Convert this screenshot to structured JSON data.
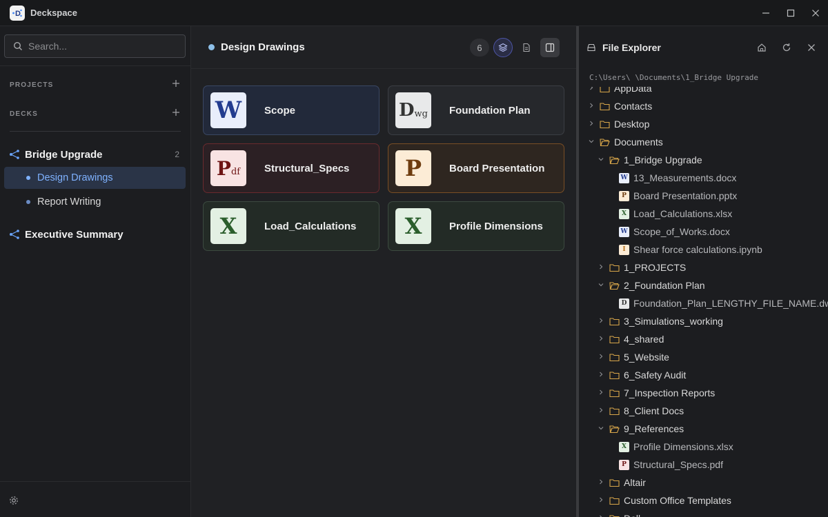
{
  "app": {
    "title": "Deckspace",
    "logo": "D"
  },
  "window_controls": [
    "minimize-icon",
    "maximize-icon",
    "close-icon"
  ],
  "sidebar": {
    "search_placeholder": "Search...",
    "sections": {
      "projects": "PROJECTS",
      "decks": "DECKS"
    },
    "projects": [
      {
        "title": "Bridge Upgrade",
        "count": "2",
        "decks": [
          {
            "label": "Design Drawings",
            "active": true
          },
          {
            "label": "Report Writing",
            "active": false
          }
        ]
      },
      {
        "title": "Executive Summary",
        "count": "",
        "decks": []
      }
    ]
  },
  "main": {
    "deck_title": "Design Drawings",
    "card_count": "6",
    "cards": [
      {
        "label": "Scope",
        "type": "word",
        "glyph": "W"
      },
      {
        "label": "Foundation Plan",
        "type": "dwg",
        "glyph": "D",
        "glyph_sub": "wg"
      },
      {
        "label": "Structural_Specs",
        "type": "pdf",
        "glyph": "P",
        "glyph_sub": "df"
      },
      {
        "label": "Board Presentation",
        "type": "ppt",
        "glyph": "P"
      },
      {
        "label": "Load_Calculations",
        "type": "excel",
        "glyph": "X"
      },
      {
        "label": "Profile Dimensions",
        "type": "excel",
        "glyph": "X"
      }
    ]
  },
  "explorer": {
    "title": "File Explorer",
    "path": "C:\\Users\\        \\Documents\\1_Bridge Upgrade",
    "tree": [
      {
        "label": "AppData",
        "kind": "folder",
        "depth": 0,
        "open": false
      },
      {
        "label": "Contacts",
        "kind": "folder",
        "depth": 0,
        "open": false
      },
      {
        "label": "Desktop",
        "kind": "folder",
        "depth": 0,
        "open": false
      },
      {
        "label": "Documents",
        "kind": "folder",
        "depth": 0,
        "open": true
      },
      {
        "label": "1_Bridge Upgrade",
        "kind": "folder",
        "depth": 1,
        "open": true
      },
      {
        "label": "13_Measurements.docx",
        "kind": "word",
        "depth": 2
      },
      {
        "label": "Board Presentation.pptx",
        "kind": "ppt",
        "depth": 2
      },
      {
        "label": "Load_Calculations.xlsx",
        "kind": "excel",
        "depth": 2
      },
      {
        "label": "Scope_of_Works.docx",
        "kind": "word",
        "depth": 2
      },
      {
        "label": "Shear force calculations.ipynb",
        "kind": "ipynb",
        "depth": 2
      },
      {
        "label": "1_PROJECTS",
        "kind": "folder",
        "depth": 1,
        "open": false
      },
      {
        "label": "2_Foundation Plan",
        "kind": "folder",
        "depth": 1,
        "open": true
      },
      {
        "label": "Foundation_Plan_LENGTHY_FILE_NAME.dwg",
        "kind": "dwg",
        "depth": 2
      },
      {
        "label": "3_Simulations_working",
        "kind": "folder",
        "depth": 1,
        "open": false
      },
      {
        "label": "4_shared",
        "kind": "folder",
        "depth": 1,
        "open": false
      },
      {
        "label": "5_Website",
        "kind": "folder",
        "depth": 1,
        "open": false
      },
      {
        "label": "6_Safety Audit",
        "kind": "folder",
        "depth": 1,
        "open": false
      },
      {
        "label": "7_Inspection Reports",
        "kind": "folder",
        "depth": 1,
        "open": false
      },
      {
        "label": "8_Client Docs",
        "kind": "folder",
        "depth": 1,
        "open": false
      },
      {
        "label": "9_References",
        "kind": "folder",
        "depth": 1,
        "open": true
      },
      {
        "label": "Profile Dimensions.xlsx",
        "kind": "excel",
        "depth": 2
      },
      {
        "label": "Structural_Specs.pdf",
        "kind": "pdf",
        "depth": 2
      },
      {
        "label": "Altair",
        "kind": "folder",
        "depth": 1,
        "open": false
      },
      {
        "label": "Custom Office Templates",
        "kind": "folder",
        "depth": 1,
        "open": false
      },
      {
        "label": "Dell",
        "kind": "folder",
        "depth": 1,
        "open": false
      }
    ]
  },
  "colors": {
    "accent": "#7fb2ff",
    "folder": "#d8a64a",
    "word": "#2b4aa0",
    "excel": "#2e6b2f",
    "pdf": "#8c1c1c",
    "ppt": "#8a4b12"
  }
}
